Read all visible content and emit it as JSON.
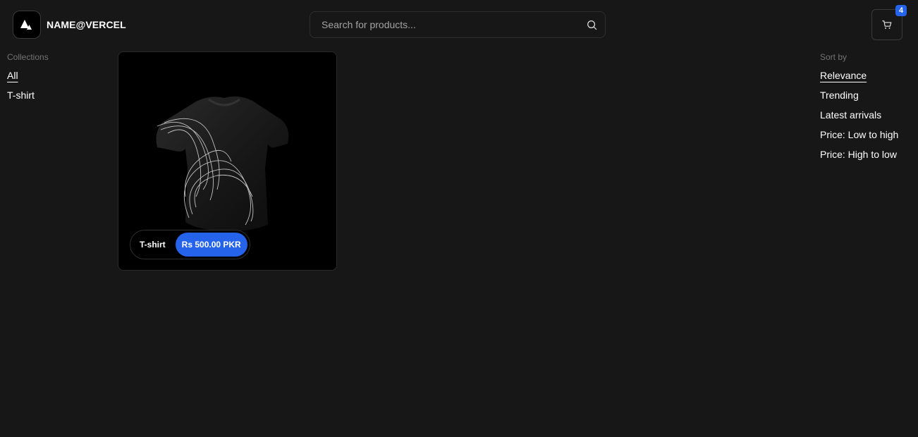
{
  "header": {
    "brand": "NAME@VERCEL",
    "search_placeholder": "Search for products...",
    "cart_count": "4"
  },
  "collections": {
    "heading": "Collections",
    "items": [
      {
        "label": "All",
        "active": true
      },
      {
        "label": "T-shirt",
        "active": false
      }
    ]
  },
  "sort": {
    "heading": "Sort by",
    "items": [
      {
        "label": "Relevance",
        "active": true
      },
      {
        "label": "Trending",
        "active": false
      },
      {
        "label": "Latest arrivals",
        "active": false
      },
      {
        "label": "Price: Low to high",
        "active": false
      },
      {
        "label": "Price: High to low",
        "active": false
      }
    ]
  },
  "products": [
    {
      "title": "T-shirt",
      "price": "Rs 500.00 PKR"
    }
  ],
  "colors": {
    "background": "#171717",
    "accent": "#2563eb",
    "card": "#000000"
  },
  "icons": {
    "logo": "vercel-triangle-icon",
    "search": "search-icon",
    "cart": "shopping-cart-icon"
  }
}
